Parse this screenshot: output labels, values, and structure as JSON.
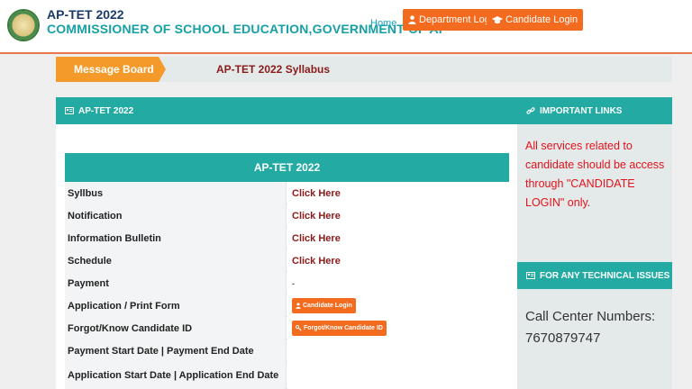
{
  "header": {
    "title": "AP-TET 2022",
    "subtitle": "COMMISSIONER OF SCHOOL EDUCATION,GOVERNMENT OF AP",
    "nav_home": "Home",
    "department_login": "Department Login",
    "candidate_login": "Candidate Login"
  },
  "message_board": {
    "label": "Message Board",
    "text": "AP-TET 2022 Syllabus"
  },
  "left_panel": {
    "title": "AP-TET 2022",
    "table_title": "AP-TET 2022",
    "rows": [
      {
        "label": "Syllbus",
        "value": "Click Here"
      },
      {
        "label": "Notification",
        "value": "Click Here"
      },
      {
        "label": "Information Bulletin",
        "value": "Click Here"
      },
      {
        "label": "Schedule",
        "value": "Click Here"
      },
      {
        "label": "Payment",
        "value": "-"
      },
      {
        "label": "Application / Print Form",
        "value": "Candidate Login"
      },
      {
        "label": "Forgot/Know Candidate ID",
        "value": "Forgot/Know Candidate ID"
      },
      {
        "label": "Payment Start Date | Payment End Date",
        "value": ""
      },
      {
        "label": "Application Start Date | Application End Date",
        "value": ""
      }
    ]
  },
  "right_panel": {
    "important_links_title": "IMPORTANT LINKS",
    "notice": "All services related to candidate should be access through \"CANDIDATE LOGIN\" only.",
    "technical_title": "FOR ANY TECHNICAL ISSUES",
    "call_center": "Call Center Numbers: 7670879747"
  },
  "colors": {
    "teal": "#23aba3",
    "orange": "#f26b1f",
    "maroon_link": "#8b1a1a",
    "notice_red": "#e5121a"
  },
  "icons": [
    "emblem-logo",
    "user-icon",
    "graduation-cap-icon",
    "id-card-icon",
    "link-icon",
    "key-icon"
  ]
}
